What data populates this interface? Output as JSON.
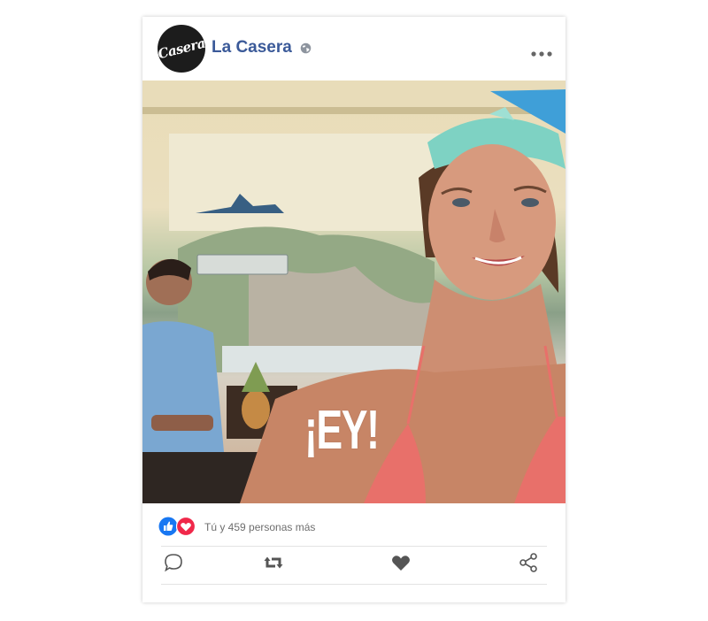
{
  "post": {
    "page_name": "La Casera",
    "avatar_logo_text": "Casera",
    "audience_icon": "globe-icon",
    "menu_icon": "more-dots-icon",
    "image_overlay_text": "¡EY!",
    "reactions": {
      "icons": [
        "like-icon",
        "love-icon"
      ],
      "text": "Tú y 459 personas más"
    },
    "actions": [
      {
        "name": "comment",
        "icon": "comment-icon"
      },
      {
        "name": "repost",
        "icon": "repost-icon"
      },
      {
        "name": "like",
        "icon": "heart-icon"
      },
      {
        "name": "share",
        "icon": "share-icon"
      }
    ]
  },
  "colors": {
    "page_name": "#3b5a99",
    "like_blue": "#1877f2",
    "love_red": "#f0284a",
    "icon_gray": "#555555"
  }
}
